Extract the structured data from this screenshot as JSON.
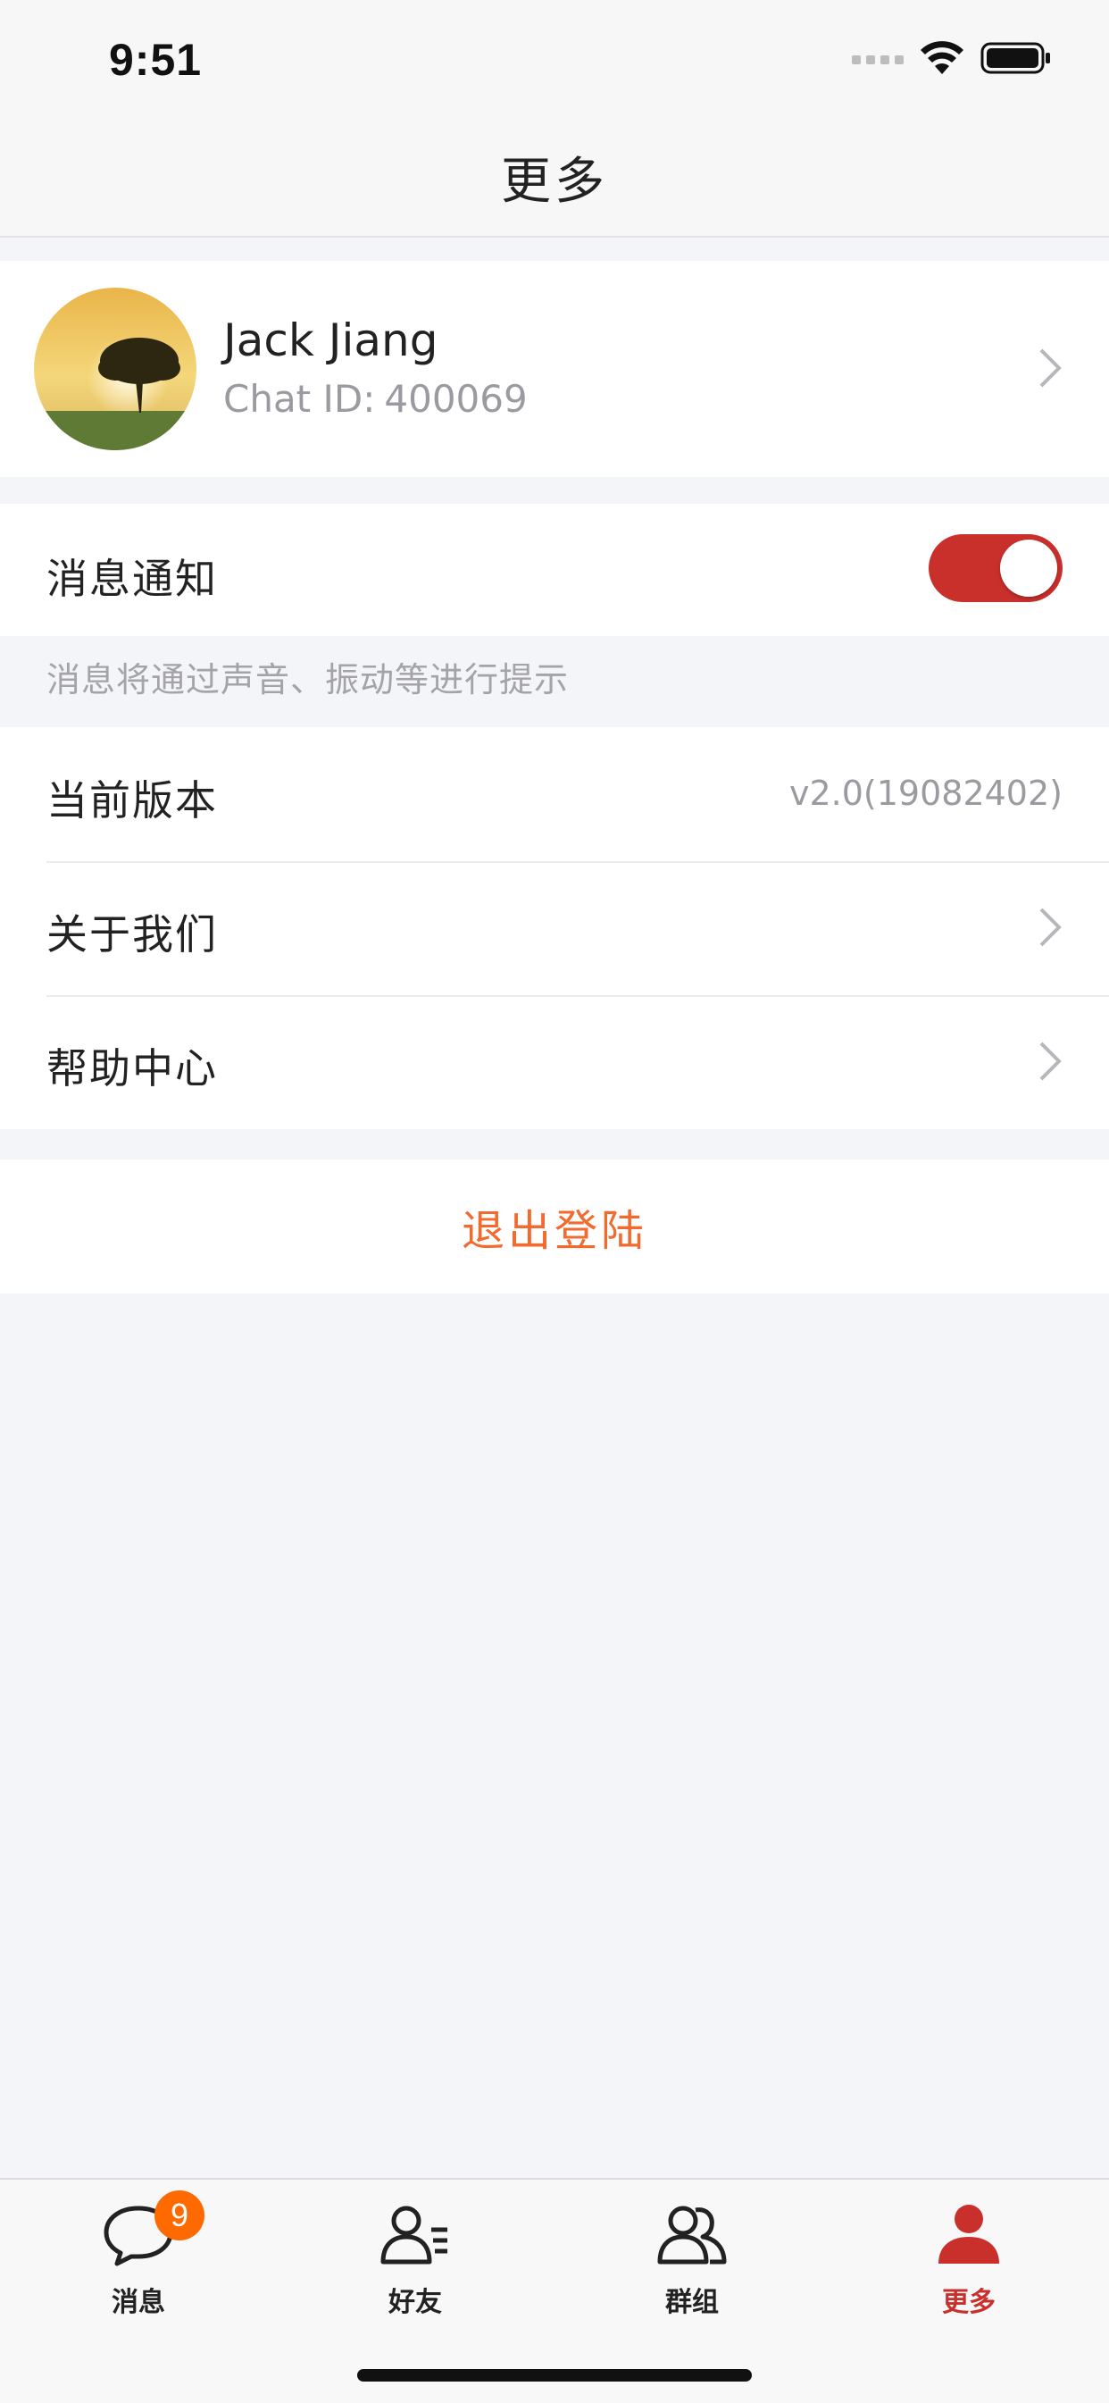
{
  "status_bar": {
    "time": "9:51",
    "signal_icon": "signal-dots-icon",
    "wifi_icon": "wifi-icon",
    "battery_icon": "battery-icon"
  },
  "header": {
    "title": "更多"
  },
  "profile": {
    "name": "Jack Jiang",
    "chat_id_label": "Chat ID:",
    "chat_id_value": "400069",
    "avatar_icon": "avatar-image",
    "chevron_icon": "chevron-right-icon"
  },
  "notifications": {
    "label": "消息通知",
    "enabled": true,
    "hint": "消息将通过声音、振动等进行提示",
    "accent_color": "#c9302c"
  },
  "settings": {
    "rows": [
      {
        "label": "当前版本",
        "value": "v2.0(19082402)"
      },
      {
        "label": "关于我们"
      },
      {
        "label": "帮助中心"
      }
    ]
  },
  "logout": {
    "label": "退出登陆",
    "color": "#f26a2e"
  },
  "tab_bar": {
    "tabs": [
      {
        "label": "消息",
        "icon": "chat-bubble-icon",
        "badge": "9",
        "active": false
      },
      {
        "label": "好友",
        "icon": "friend-list-icon",
        "active": false
      },
      {
        "label": "群组",
        "icon": "group-icon",
        "active": false
      },
      {
        "label": "更多",
        "icon": "person-icon",
        "active": true
      }
    ],
    "active_color": "#c9302c",
    "badge_color": "#ff6a00"
  }
}
